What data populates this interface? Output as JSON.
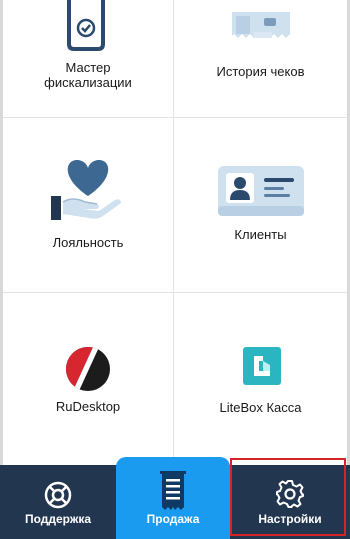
{
  "tiles": [
    {
      "label": "Мастер\nфискализации",
      "icon": "fiscal-wizard-icon"
    },
    {
      "label": "История чеков",
      "icon": "receipt-history-icon"
    },
    {
      "label": "Лояльность",
      "icon": "loyalty-heart-hand-icon"
    },
    {
      "label": "Клиенты",
      "icon": "client-card-icon"
    },
    {
      "label": "RuDesktop",
      "icon": "rudesktop-logo-icon"
    },
    {
      "label": "LiteBox Касса",
      "icon": "litebox-logo-icon"
    }
  ],
  "bottom_nav": {
    "support_label": "Поддержка",
    "sales_label": "Продажа",
    "settings_label": "Настройки",
    "active": "Продажа",
    "highlighted": "Настройки"
  },
  "colors": {
    "nav_background": "#223650",
    "active_tab": "#1a9bf0",
    "highlight_border": "#d6232a",
    "icon_dark": "#2b4a6e",
    "icon_light": "#cfe0ef",
    "litebox_teal": "#2bb5c0",
    "rudesktop_red": "#d7262f"
  }
}
